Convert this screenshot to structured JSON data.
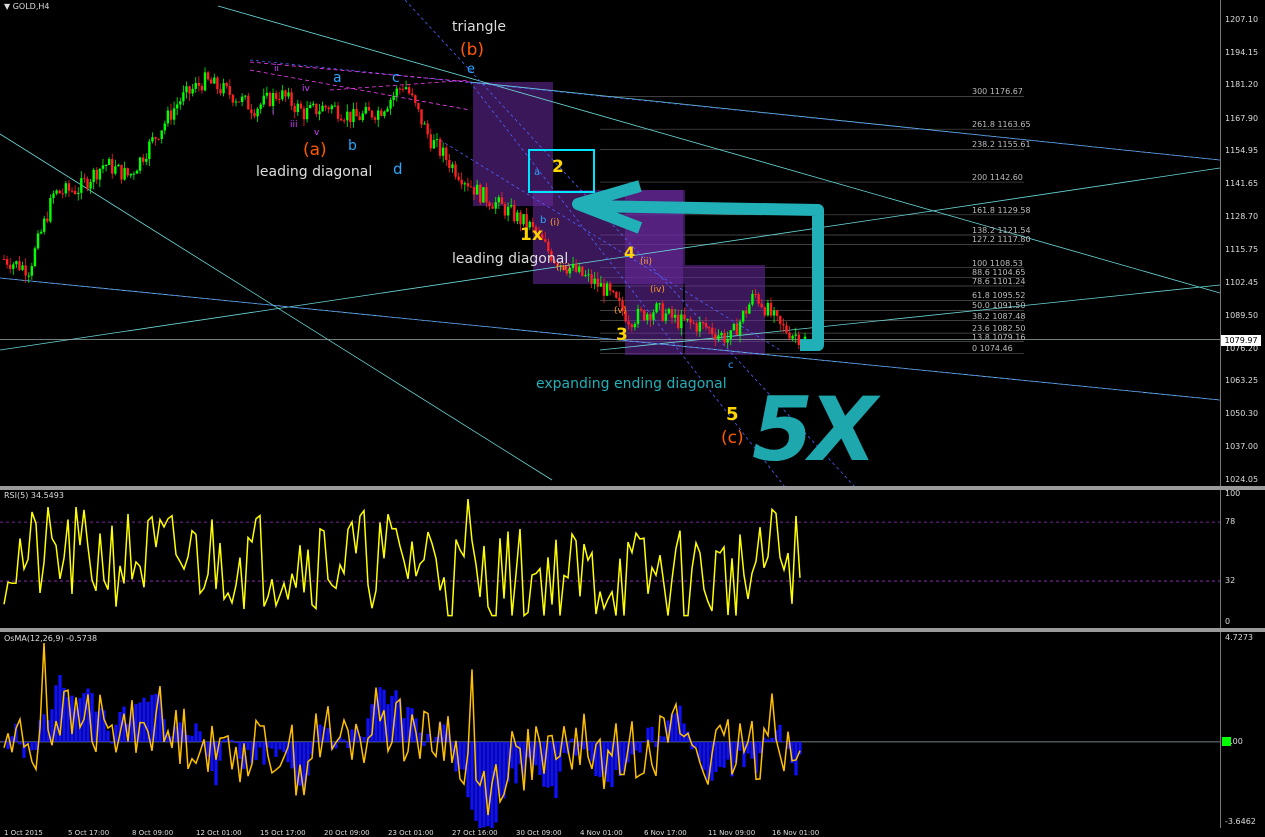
{
  "symbol_label": "GOLD,H4",
  "rsi_label": "RSI(5) 34.5493",
  "osma_label": "OsMA(12,26,9) -0.5738",
  "current_price": "1079.97",
  "colors": {
    "up": "#00ff00",
    "down": "#ff2020",
    "rsi": "#ffff00",
    "hist": "#1010ff",
    "signal": "#ffc000",
    "cyan": "#00e5ff",
    "annot": "#21b0b8",
    "zone": "#6a2aa0",
    "red_label": "#ff5a00",
    "yellow_label": "#ffd400",
    "blue_label": "#2aa8ff"
  },
  "price_axis_ticks": [
    "1207.10",
    "1194.15",
    "1181.20",
    "1167.90",
    "1154.95",
    "1141.65",
    "1128.70",
    "1115.75",
    "1102.45",
    "1089.50",
    "1076.20",
    "1063.25",
    "1050.30",
    "1037.00",
    "1024.05"
  ],
  "rsi_axis_ticks": [
    "100",
    "78",
    "32",
    "0"
  ],
  "osma_axis_ticks": [
    "4.7273",
    "0.00",
    "-3.6462"
  ],
  "fib_levels": [
    "300 1176.67",
    "261.8 1163.65",
    "238.2 1155.61",
    "200 1142.60",
    "161.8 1129.58",
    "138.2 1121.54",
    "127.2 1117.80",
    "100 1108.53",
    "88.6 1104.65",
    "78.6 1101.24",
    "61.8 1095.52",
    "50.0 1091.50",
    "38.2 1087.48",
    "23.6 1082.50",
    "13.8 1079.16",
    "0 1074.46"
  ],
  "time_axis": [
    "1 Oct 2015",
    "5 Oct 17:00",
    "8 Oct 09:00",
    "12 Oct 01:00",
    "15 Oct 17:00",
    "20 Oct 09:00",
    "23 Oct 01:00",
    "27 Oct 16:00",
    "30 Oct 09:00",
    "4 Nov 01:00",
    "6 Nov 17:00",
    "11 Nov 09:00",
    "16 Nov 01:00"
  ],
  "annotations": {
    "triangle": "triangle",
    "b_paren": "(b)",
    "e_top": "e",
    "a": "a",
    "b": "b",
    "c": "c",
    "d": "d",
    "a_paren": "(a)",
    "leading1": "leading diagonal",
    "leading2": "leading diagonal",
    "two": "2",
    "onex": "1x",
    "four": "4",
    "three": "3",
    "five": "5",
    "c_paren": "(c)",
    "expanding": "expanding ending diagonal",
    "fivex": "5X",
    "roman_i": "i",
    "roman_ii": "ii",
    "roman_iii": "iii",
    "roman_iv": "iv",
    "roman_v": "v",
    "sub_i": "(i)",
    "sub_ii": "(ii)",
    "sub_iii": "(iii)",
    "sub_iv": "(iv)",
    "sub_v": "(v)",
    "small_a": "a",
    "small_b": "b",
    "small_c": "c"
  },
  "chart_data": [
    {
      "type": "candlestick",
      "title": "GOLD,H4",
      "ylim": [
        1024.05,
        1207.1
      ],
      "x_range": [
        "1 Oct 2015",
        "17 Nov 2015"
      ],
      "approx_close_path": [
        1112,
        1108,
        1138,
        1140,
        1150,
        1145,
        1160,
        1175,
        1183,
        1178,
        1172,
        1178,
        1170,
        1173,
        1168,
        1171,
        1182,
        1160,
        1148,
        1138,
        1132,
        1125,
        1112,
        1106,
        1100,
        1088,
        1092,
        1087,
        1085,
        1080,
        1098,
        1085,
        1080
      ],
      "last_price": 1079.97
    },
    {
      "type": "line",
      "title": "RSI(5) 34.5493",
      "ylim": [
        0,
        100
      ],
      "levels": [
        78,
        32
      ],
      "last_value": 34.5493
    },
    {
      "type": "area",
      "title": "OsMA(12,26,9) -0.5738",
      "ylim": [
        -3.6462,
        4.7273
      ],
      "last_value": -0.5738
    }
  ]
}
